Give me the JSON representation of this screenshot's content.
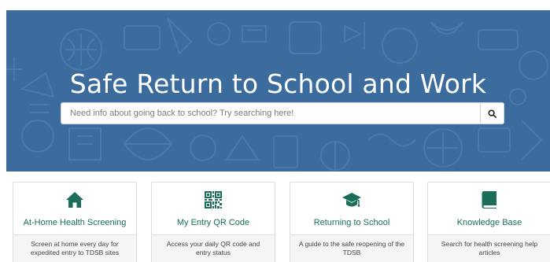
{
  "hero": {
    "title": "Safe Return to School and Work",
    "search_placeholder": "Need info about going back to school? Try searching here!",
    "background_color": "#3c6b9e"
  },
  "accent_color": "#1a6e5a",
  "cards": [
    {
      "icon": "home-icon",
      "title": "At-Home Health Screening",
      "description": "Screen at home every day for expedited entry to TDSB sites"
    },
    {
      "icon": "qr-code-icon",
      "title": "My Entry QR Code",
      "description": "Access your daily QR code and entry status"
    },
    {
      "icon": "graduation-cap-icon",
      "title": "Returning to School",
      "description": "A guide to the safe reopening of the TDSB"
    },
    {
      "icon": "book-icon",
      "title": "Knowledge Base",
      "description": "Search for health screening help articles"
    }
  ]
}
